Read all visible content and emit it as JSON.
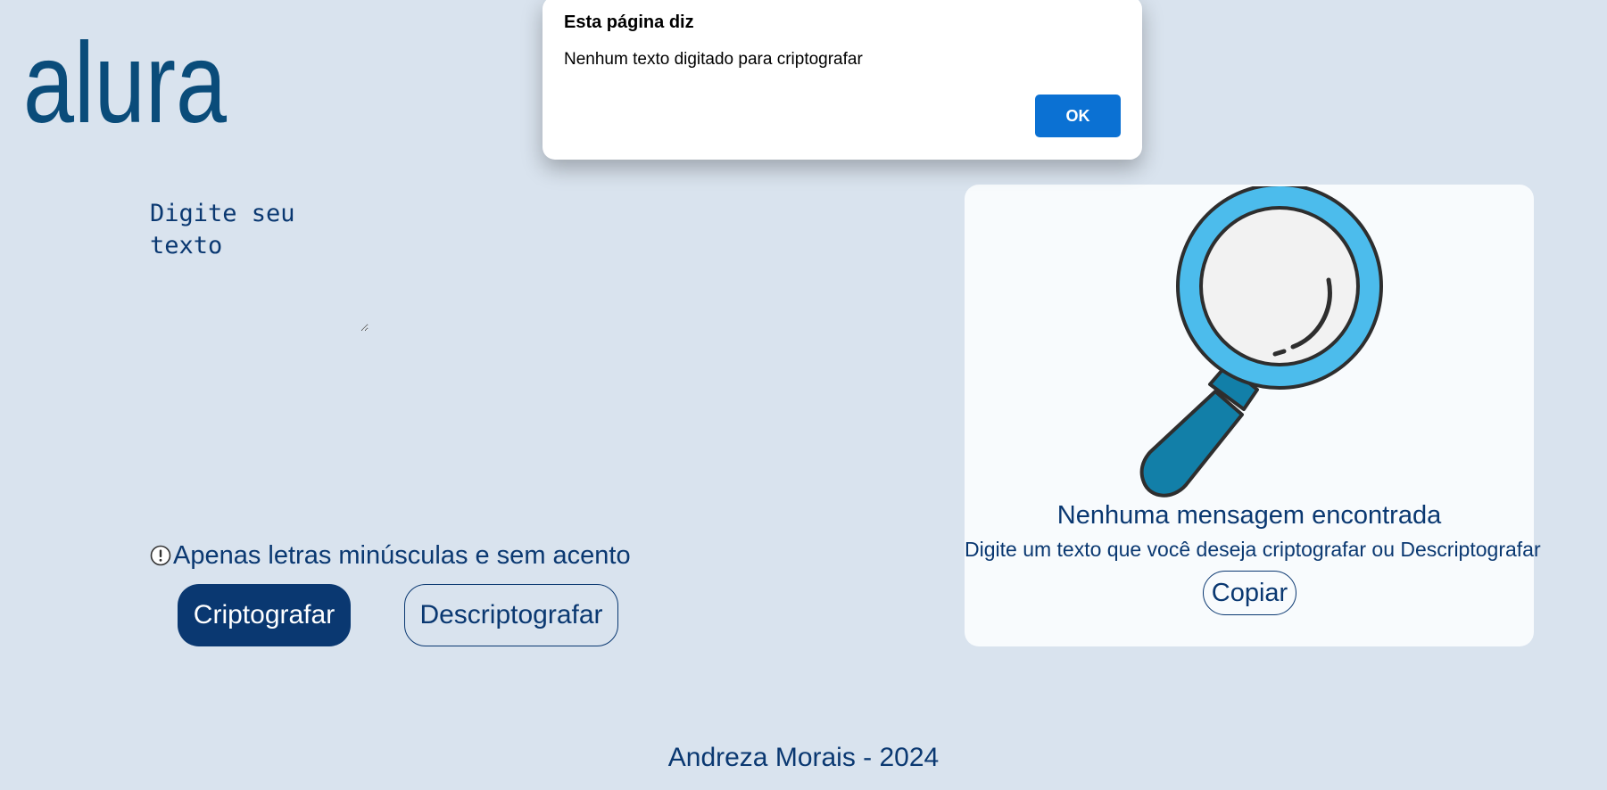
{
  "logo": {
    "text": "alura",
    "color": "#0a4c7a"
  },
  "input": {
    "placeholder": "Digite seu texto"
  },
  "hint": {
    "icon": "exclamation-circle-icon",
    "text": "Apenas letras minúsculas e sem acento"
  },
  "buttons": {
    "encrypt_label": "Criptografar",
    "decrypt_label": "Descriptografar"
  },
  "output_panel": {
    "icon": "magnifying-glass-icon",
    "title": "Nenhuma mensagem encontrada",
    "subtitle": "Digite um texto que você deseja criptografar ou Descriptografar",
    "copy_label": "Copiar"
  },
  "footer": {
    "text": "Andreza Morais - 2024"
  },
  "dialog": {
    "title": "Esta página diz",
    "message": "Nenhum texto digitado para criptografar",
    "ok_label": "OK"
  },
  "colors": {
    "background": "#d9e3ee",
    "primary": "#0a3871",
    "panel": "#f8fbfd",
    "dialog_button": "#0b71d3"
  }
}
